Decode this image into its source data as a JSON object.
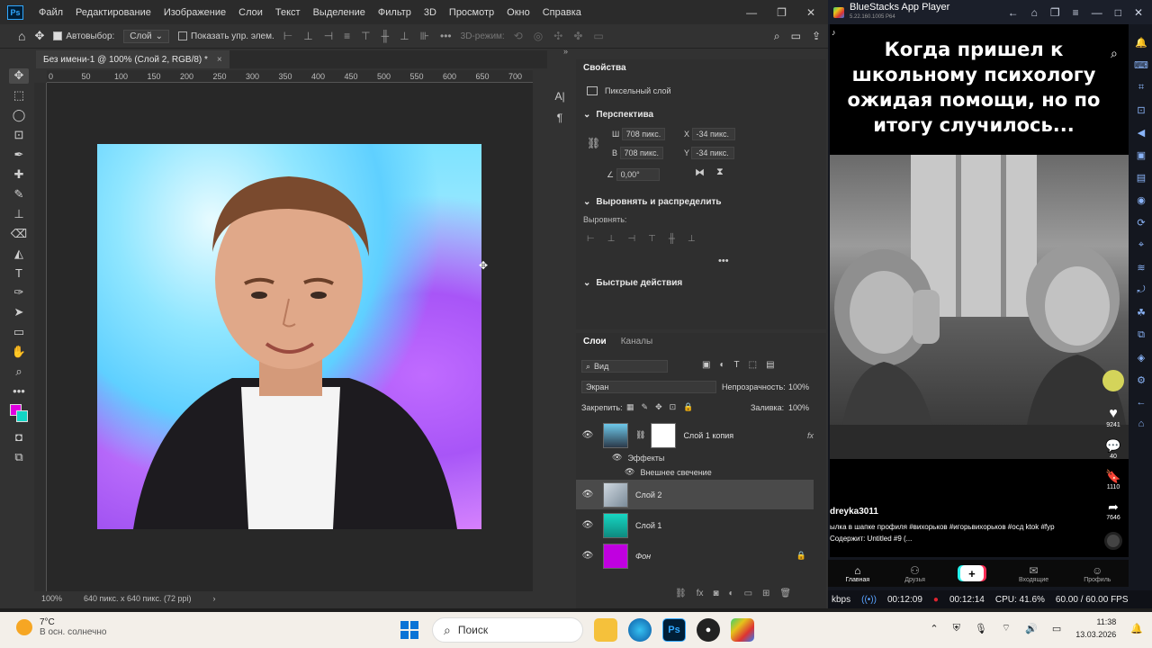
{
  "photoshop": {
    "menu": [
      "Файл",
      "Редактирование",
      "Изображение",
      "Слои",
      "Текст",
      "Выделение",
      "Фильтр",
      "3D",
      "Просмотр",
      "Окно",
      "Справка"
    ],
    "options": {
      "autoselect_label": "Автовыбор:",
      "autoselect_value": "Слой",
      "show_transform_label": "Показать упр. элем.",
      "mode_3d": "3D-режим:"
    },
    "document_tab": "Без имени-1 @ 100% (Слой 2, RGB/8) *",
    "ruler_ticks": [
      "0",
      "50",
      "100",
      "150",
      "200",
      "250",
      "300",
      "350",
      "400",
      "450",
      "500",
      "550",
      "600",
      "650",
      "700"
    ],
    "status_zoom": "100%",
    "status_doc": "640 пикс. x 640 пикс. (72 ppi)",
    "properties": {
      "tab": "Свойства",
      "layer_kind": "Пиксельный слой",
      "section_perspective": "Перспектива",
      "w_label": "Ш",
      "w_value": "708 пикс.",
      "h_label": "В",
      "h_value": "708 пикс.",
      "x_label": "X",
      "x_value": "-34 пикс.",
      "y_label": "Y",
      "y_value": "-34 пикс.",
      "angle_value": "0,00°",
      "section_align": "Выровнять и распределить",
      "align_label": "Выровнять:",
      "section_quick": "Быстрые действия"
    },
    "layers": {
      "tabs": [
        "Слои",
        "Каналы"
      ],
      "filter_kind": "Вид",
      "blend_mode": "Экран",
      "opacity_label": "Непрозрачность:",
      "opacity_value": "100%",
      "lock_label": "Закрепить:",
      "fill_label": "Заливка:",
      "fill_value": "100%",
      "items": [
        {
          "name": "Слой 1 копия",
          "fx": "fx"
        },
        {
          "name": "Слой 2"
        },
        {
          "name": "Слой 1"
        },
        {
          "name": "Фон"
        }
      ],
      "effects_label": "Эффекты",
      "outer_glow_label": "Внешнее свечение"
    }
  },
  "bluestacks": {
    "title": "BlueStacks App Player",
    "version": "5.22.160.1005 P64",
    "caption": "Когда пришел к школьному психологу ожидая помощи, но по итогу случилось...",
    "username": "dreyka3011",
    "description": "ылка в шапке профиля #вихорьков #игорьвихорьков #осд ktok #fyp",
    "sound": "Содержит: Untitled #9 (...",
    "likes": "9241",
    "comments": "40",
    "saves": "1110",
    "shares": "7646",
    "nav": [
      "Главная",
      "Друзья",
      "+",
      "Входящие",
      "Профиль"
    ],
    "status": {
      "bitrate": "kbps",
      "time1": "00:12:09",
      "time2": "00:12:14",
      "cpu": "CPU: 41.6%",
      "fps": "60.00 / 60.00 FPS"
    }
  },
  "taskbar": {
    "temperature": "7°C",
    "weather": "В осн. солнечно",
    "search": "Поиск",
    "time": "11:38",
    "date": "13.03.2026"
  }
}
